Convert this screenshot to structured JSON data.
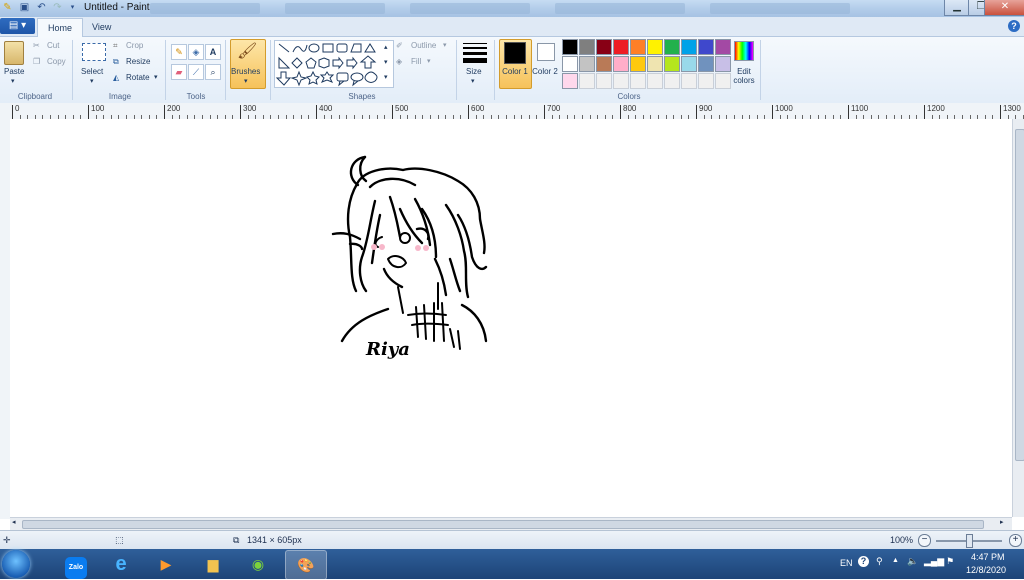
{
  "window": {
    "title": "Untitled - Paint"
  },
  "tabs": {
    "file": "▤ ▾",
    "home": "Home",
    "view": "View"
  },
  "ribbon": {
    "clipboard": {
      "paste": "Paste",
      "cut": "Cut",
      "copy": "Copy",
      "label": "Clipboard"
    },
    "image": {
      "select": "Select",
      "crop": "Crop",
      "resize": "Resize",
      "rotate": "Rotate",
      "label": "Image"
    },
    "tools": {
      "label": "Tools"
    },
    "brushes": {
      "label": "Brushes"
    },
    "shapes": {
      "outline": "Outline",
      "fill": "Fill",
      "label": "Shapes"
    },
    "size": {
      "label": "Size"
    },
    "colors": {
      "color1": "Color 1",
      "color2": "Color 2",
      "edit": "Edit colors",
      "label": "Colors",
      "palette_row1": [
        "#000000",
        "#7f7f7f",
        "#880015",
        "#ed1c24",
        "#ff7f27",
        "#fff200",
        "#22b14c",
        "#00a2e8",
        "#3f48cc",
        "#a349a4"
      ],
      "palette_row2": [
        "#ffffff",
        "#c3c3c3",
        "#b97a57",
        "#ffaec9",
        "#ffc90e",
        "#efe4b0",
        "#b5e61d",
        "#99d9ea",
        "#7092be",
        "#c8bfe7"
      ],
      "palette_row3": [
        "#ffd8ec"
      ]
    }
  },
  "ruler": {
    "ticks": [
      "0",
      "100",
      "200",
      "300",
      "400",
      "500",
      "600",
      "700",
      "800",
      "900",
      "1000",
      "1100",
      "1200",
      "1300"
    ]
  },
  "canvas": {
    "signature": "Riya"
  },
  "status": {
    "size": "1341 × 605px",
    "zoom": "100%"
  },
  "taskbar": {
    "zalo": "Zalo",
    "lang": "EN",
    "time": "4:47 PM",
    "date": "12/8/2020"
  }
}
